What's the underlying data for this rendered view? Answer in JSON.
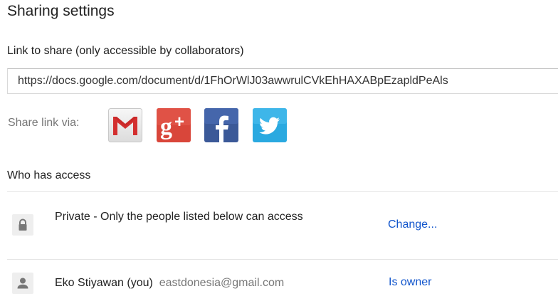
{
  "dialog": {
    "title": "Sharing settings"
  },
  "link": {
    "label": "Link to share (only accessible by collaborators)",
    "value": "https://docs.google.com/document/d/1FhOrWlJ03awwrulCVkEhHAXABpEzapldPeAls"
  },
  "share_via": {
    "label": "Share link via:",
    "services": [
      {
        "name": "Gmail",
        "icon": "gmail-icon",
        "color": "#d93025"
      },
      {
        "name": "Google+",
        "icon": "google-plus-icon",
        "color": "#dd4b39"
      },
      {
        "name": "Facebook",
        "icon": "facebook-icon",
        "color": "#3b5998"
      },
      {
        "name": "Twitter",
        "icon": "twitter-icon",
        "color": "#1da1f2"
      }
    ]
  },
  "access": {
    "heading": "Who has access",
    "rows": [
      {
        "icon": "lock-icon",
        "text": "Private - Only the people listed below can access",
        "action": "Change..."
      },
      {
        "icon": "person-icon",
        "name": "Eko Stiyawan (you)",
        "email": "eastdonesia@gmail.com",
        "action": "Is owner"
      }
    ]
  },
  "colors": {
    "link": "#1155cc",
    "muted_text": "#777777",
    "divider": "#e5e5e5"
  }
}
